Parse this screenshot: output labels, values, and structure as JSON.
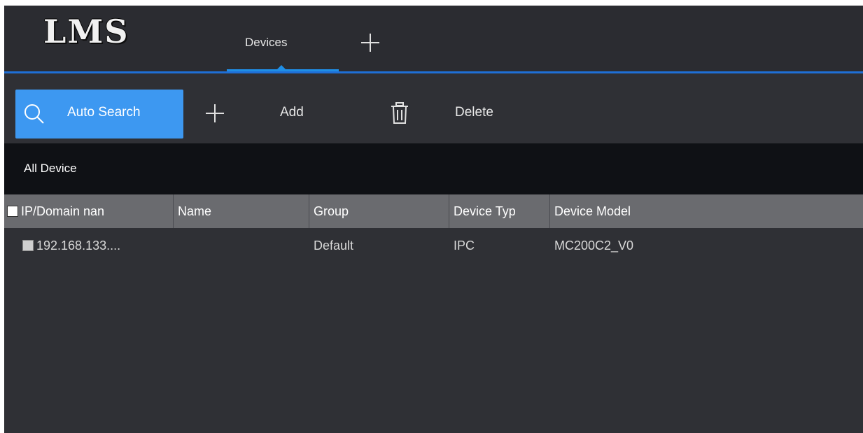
{
  "app": {
    "logo_text": "LMS"
  },
  "tabs": [
    {
      "label": "Devices",
      "active": true
    }
  ],
  "add_tab_icon": "plus-icon",
  "toolbar": {
    "auto_search_label": "Auto Search",
    "add_label": "Add",
    "delete_label": "Delete",
    "auto_search_icon": "search-icon",
    "add_icon": "plus-icon",
    "delete_icon": "trash-icon"
  },
  "group": {
    "label": "All Device"
  },
  "table": {
    "columns": [
      "IP/Domain nan",
      "Name",
      "Group",
      "Device Typ",
      "Device Model"
    ],
    "rows": [
      {
        "ip": "192.168.133....",
        "name": "",
        "group": "Default",
        "device_type": "IPC",
        "device_model": "MC200C2_V0",
        "checked": false
      }
    ]
  },
  "colors": {
    "background": "#2f3035",
    "accent": "#3d98f1",
    "tab_underline": "#1f8ee6",
    "header_band": "#0f1115",
    "table_header": "#6a6b6f"
  }
}
